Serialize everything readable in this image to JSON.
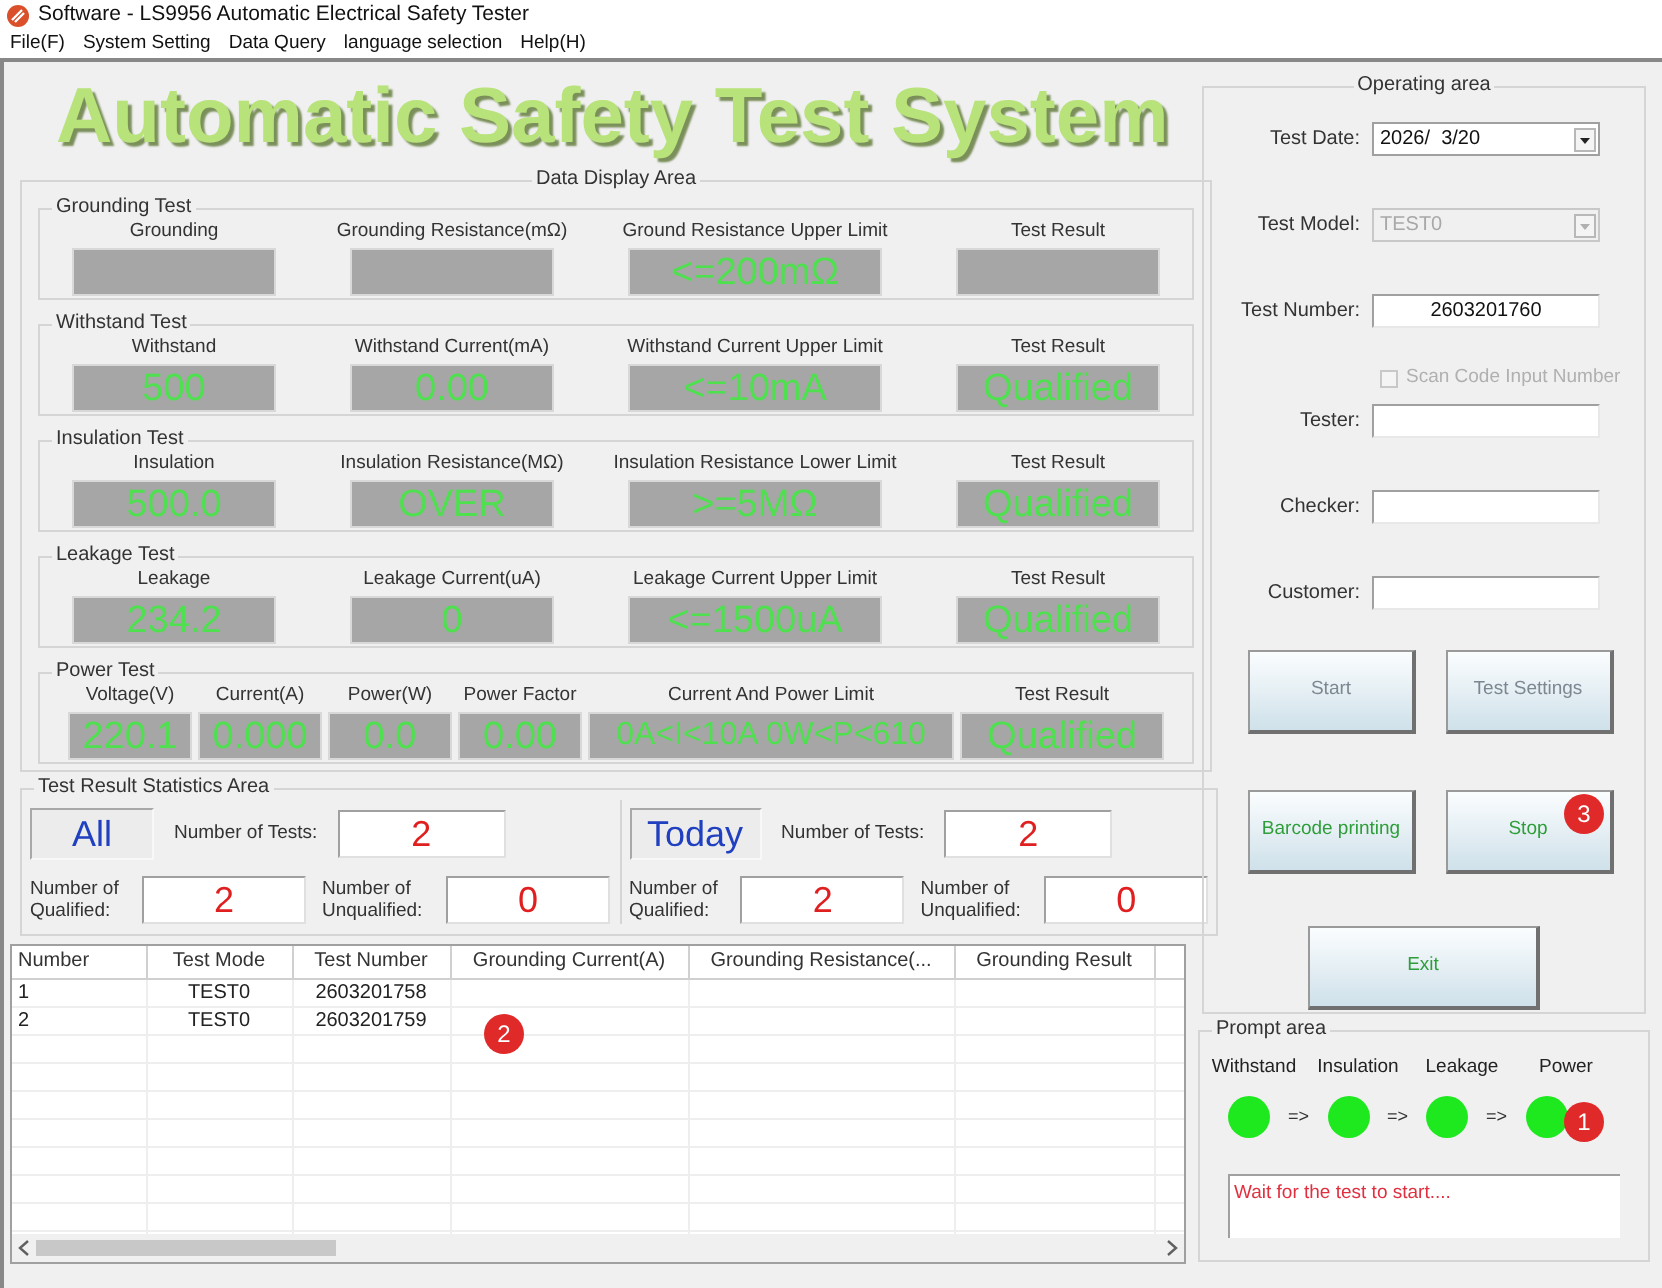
{
  "window": {
    "title": "Software - LS9956 Automatic Electrical Safety Tester"
  },
  "menu": [
    "File(F)",
    "System Setting",
    "Data Query",
    "language selection",
    "Help(H)"
  ],
  "banner": "Automatic Safety Test System",
  "data_display": {
    "title": "Data Display Area",
    "sections": [
      {
        "title": "Grounding Test",
        "kind": "standard",
        "fields": [
          {
            "label": "Grounding"
          },
          {
            "label": "Grounding Resistance(mΩ)"
          },
          {
            "label": "Ground Resistance Upper Limit",
            "value": "<=200mΩ"
          },
          {
            "label": "Test Result"
          }
        ]
      },
      {
        "title": "Withstand Test",
        "kind": "standard",
        "fields": [
          {
            "label": "Withstand",
            "value": "500"
          },
          {
            "label": "Withstand Current(mA)",
            "value": "0.00"
          },
          {
            "label": "Withstand Current Upper Limit",
            "value": "<=10mA"
          },
          {
            "label": "Test Result",
            "value": "Qualified"
          }
        ]
      },
      {
        "title": "Insulation Test",
        "kind": "standard",
        "fields": [
          {
            "label": "Insulation",
            "value": "500.0"
          },
          {
            "label": "Insulation Resistance(MΩ)",
            "value": "OVER"
          },
          {
            "label": "Insulation Resistance Lower Limit",
            "value": ">=5MΩ"
          },
          {
            "label": "Test Result",
            "value": "Qualified"
          }
        ]
      },
      {
        "title": "Leakage Test",
        "kind": "standard",
        "fields": [
          {
            "label": "Leakage",
            "value": "234.2"
          },
          {
            "label": "Leakage Current(uA)",
            "value": "0"
          },
          {
            "label": "Leakage Current Upper Limit",
            "value": "<=1500uA"
          },
          {
            "label": "Test Result",
            "value": "Qualified"
          }
        ]
      },
      {
        "title": "Power Test",
        "kind": "power",
        "fields": [
          {
            "label": "Voltage(V)",
            "value": "220.1"
          },
          {
            "label": "Current(A)",
            "value": "0.000"
          },
          {
            "label": "Power(W)",
            "value": "0.0"
          },
          {
            "label": "Power Factor",
            "value": "0.00"
          },
          {
            "label": "Current And Power Limit",
            "value": "0A<I<10A 0W<P<610"
          },
          {
            "label": "Test Result",
            "value": "Qualified"
          }
        ]
      }
    ]
  },
  "statistics": {
    "title": "Test Result Statistics Area",
    "groups": [
      {
        "scope": "All",
        "tests_label": "Number of Tests:",
        "tests": "2",
        "qualified_label": "Number of Qualified:",
        "qualified": "2",
        "unqualified_label": "Number of Unqualified:",
        "unqualified": "0"
      },
      {
        "scope": "Today",
        "tests_label": "Number of Tests:",
        "tests": "2",
        "qualified_label": "Number of Qualified:",
        "qualified": "2",
        "unqualified_label": "Number of Unqualified:",
        "unqualified": "0"
      }
    ]
  },
  "table": {
    "columns": [
      "Number",
      "Test Mode",
      "Test Number",
      "Grounding Current(A)",
      "Grounding Resistance(...",
      "Grounding Result"
    ],
    "rows": [
      [
        "1",
        "TEST0",
        "2603201758"
      ],
      [
        "2",
        "TEST0",
        "2603201759"
      ]
    ],
    "badge": "2"
  },
  "operating_area": {
    "title": "Operating area",
    "fields": [
      {
        "kind": "select",
        "label": "Test Date:",
        "value": "2026/  3/20",
        "disabled": false
      },
      {
        "kind": "select",
        "label": "Test Model:",
        "value": "TEST0",
        "disabled": true
      },
      {
        "kind": "text",
        "label": "Test Number:",
        "value": "2603201760"
      },
      {
        "kind": "checkbox",
        "label": "Scan Code Input Number",
        "checked": false,
        "disabled": true
      },
      {
        "kind": "text",
        "label": "Tester:"
      },
      {
        "kind": "text",
        "label": "Checker:"
      },
      {
        "kind": "text",
        "label": "Customer:"
      }
    ],
    "buttons": [
      {
        "label": "Start",
        "disabled": true
      },
      {
        "label": "Test Settings",
        "disabled": true
      },
      {
        "label": "Barcode printing",
        "disabled": false
      },
      {
        "label": "Stop",
        "disabled": false,
        "badge": "3"
      },
      {
        "label": "Exit",
        "disabled": false
      }
    ]
  },
  "prompt_area": {
    "title": "Prompt area",
    "stages": [
      {
        "label": "Withstand",
        "on": true
      },
      {
        "label": "Insulation",
        "on": true,
        "arrow": "=>"
      },
      {
        "label": "Leakage",
        "on": true,
        "arrow": "=>"
      },
      {
        "label": "Power",
        "on": true,
        "arrow": "=>"
      }
    ],
    "badge": "1",
    "message": "Wait for the test to start...."
  }
}
